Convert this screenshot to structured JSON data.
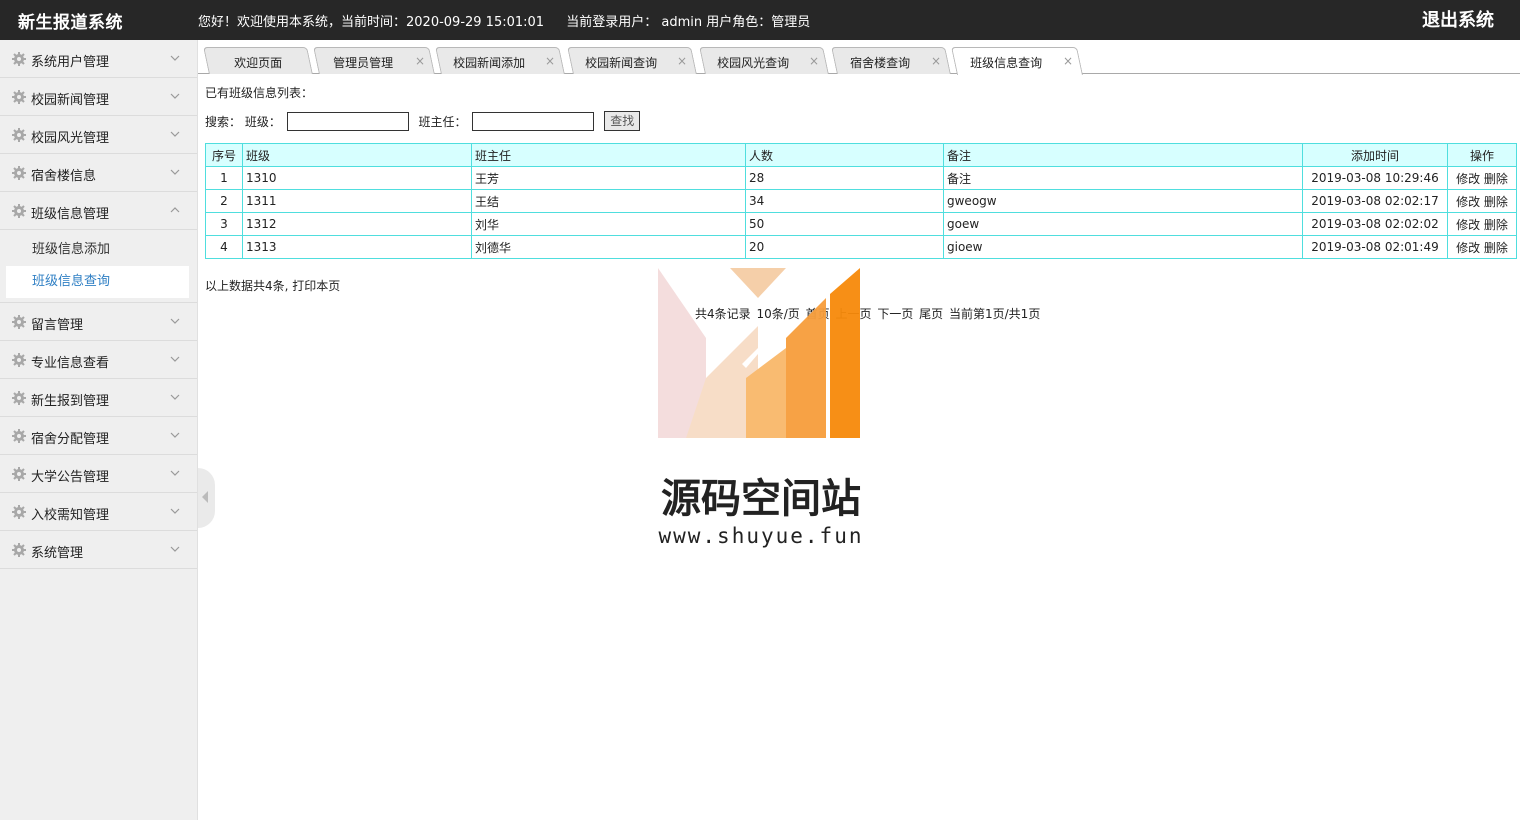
{
  "header": {
    "app_title": "新生报道系统",
    "welcome": "您好！欢迎使用本系统，当前时间：2020-09-29 15:01:01",
    "user_info": "当前登录用户： admin 用户角色：管理员",
    "logout": "退出系统"
  },
  "sidebar": {
    "items": [
      {
        "label": "系统用户管理"
      },
      {
        "label": "校园新闻管理"
      },
      {
        "label": "校园风光管理"
      },
      {
        "label": "宿舍楼信息"
      },
      {
        "label": "班级信息管理",
        "expanded": true
      },
      {
        "label": "留言管理"
      },
      {
        "label": "专业信息查看"
      },
      {
        "label": "新生报到管理"
      },
      {
        "label": "宿舍分配管理"
      },
      {
        "label": "大学公告管理"
      },
      {
        "label": "入校需知管理"
      },
      {
        "label": "系统管理"
      }
    ],
    "submenu": [
      {
        "label": "班级信息添加"
      },
      {
        "label": "班级信息查询",
        "active": true
      }
    ]
  },
  "tabs": [
    {
      "label": "欢迎页面"
    },
    {
      "label": "管理员管理"
    },
    {
      "label": "校园新闻添加"
    },
    {
      "label": "校园新闻查询"
    },
    {
      "label": "校园风光查询"
    },
    {
      "label": "宿舍楼查询"
    },
    {
      "label": "班级信息查询",
      "active": true
    }
  ],
  "tab_close_glyph": "×",
  "content": {
    "list_title": "已有班级信息列表：",
    "search": {
      "prefix": "搜索：",
      "class_label": "班级：",
      "class_value": "",
      "teacher_label": "班主任：",
      "teacher_value": "",
      "button": "查找"
    },
    "table": {
      "headers": [
        "序号",
        "班级",
        "班主任",
        "人数",
        "备注",
        "添加时间",
        "操作"
      ],
      "rows": [
        {
          "no": "1",
          "class": "1310",
          "teacher": "王芳",
          "count": "28",
          "note": "备注",
          "time": "2019-03-08 10:29:46"
        },
        {
          "no": "2",
          "class": "1311",
          "teacher": "王结",
          "count": "34",
          "note": "gweogw",
          "time": "2019-03-08 02:02:17"
        },
        {
          "no": "3",
          "class": "1312",
          "teacher": "刘华",
          "count": "50",
          "note": "goew",
          "time": "2019-03-08 02:02:02"
        },
        {
          "no": "4",
          "class": "1313",
          "teacher": "刘德华",
          "count": "20",
          "note": "gioew",
          "time": "2019-03-08 02:01:49"
        }
      ],
      "edit_label": "修改",
      "delete_label": "删除"
    },
    "summary_text": "以上数据共4条, ",
    "print_link": "打印本页",
    "pager": {
      "records": "共4条记录",
      "per_page": "10条/页",
      "first": "首页",
      "prev": "上一页",
      "next": "下一页",
      "last": "尾页",
      "current": "当前第1页/共1页"
    }
  },
  "watermark": {
    "name": "源码空间站",
    "url": "www.shuyue.fun"
  },
  "colors": {
    "header_bg": "#272727",
    "sidebar_bg": "#efefef",
    "active_link": "#2f7fc4",
    "table_border": "#4fdede",
    "table_header_bg": "#d7ffff",
    "watermark_orange": "#f78a0a"
  }
}
